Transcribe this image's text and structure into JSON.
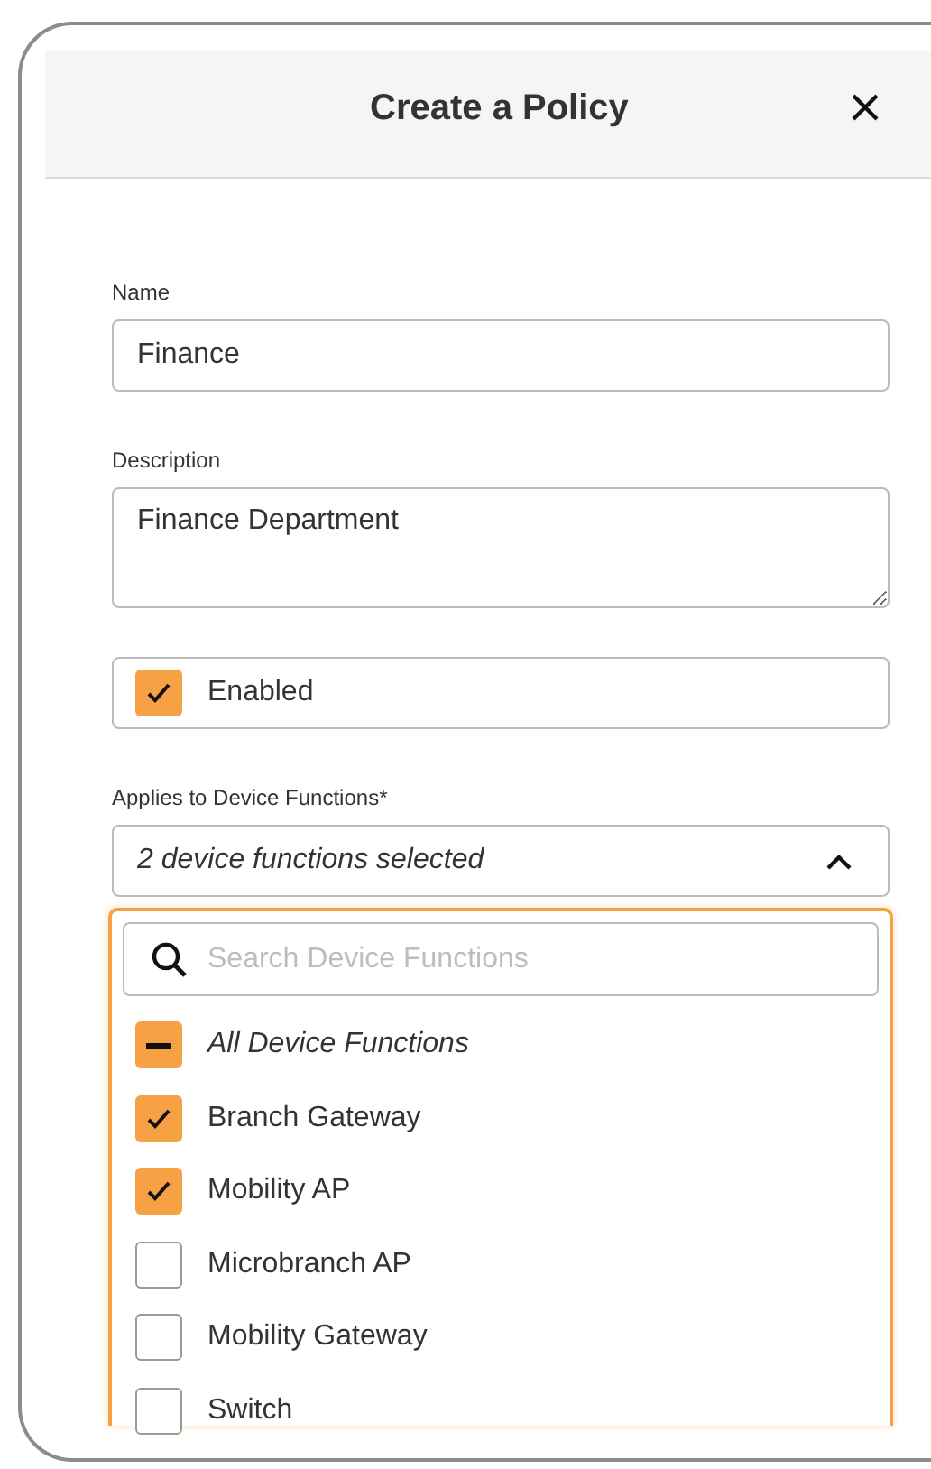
{
  "dialog": {
    "title": "Create a Policy"
  },
  "name_field": {
    "label": "Name",
    "value": "Finance"
  },
  "description_field": {
    "label": "Description",
    "value": "Finance Department"
  },
  "enabled": {
    "label": "Enabled",
    "checked": true
  },
  "device_functions": {
    "label": "Applies to Device Functions*",
    "value": "2 device functions selected",
    "expanded": true,
    "search": {
      "placeholder": "Search Device Functions"
    },
    "options": [
      {
        "kind": "all",
        "label": "All Device Functions",
        "checked": false,
        "indeterminate": true
      },
      {
        "kind": "option",
        "label": "Branch Gateway",
        "checked": true
      },
      {
        "kind": "option",
        "label": "Mobility AP",
        "checked": true
      },
      {
        "kind": "option",
        "label": "Microbranch AP",
        "checked": false
      },
      {
        "kind": "option",
        "label": "Mobility Gateway",
        "checked": false
      },
      {
        "kind": "option",
        "label": "Switch",
        "checked": false
      }
    ]
  }
}
